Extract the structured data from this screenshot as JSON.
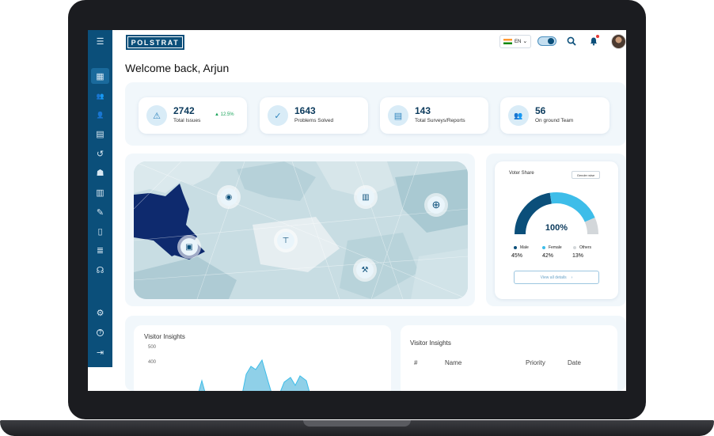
{
  "brand": {
    "name": "POLSTRAT"
  },
  "header": {
    "language": "EN",
    "language_chevron": "⌄",
    "icons": [
      "search-icon",
      "bell-icon"
    ]
  },
  "welcome": "Welcome back, Arjun",
  "sidebar": {
    "items": [
      {
        "icon": "menu-icon",
        "glyph": "☰"
      },
      {
        "icon": "dashboard-icon",
        "glyph": "▦",
        "active": true
      },
      {
        "icon": "team-icon",
        "glyph": "👥"
      },
      {
        "icon": "people-icon",
        "glyph": "👤"
      },
      {
        "icon": "document-icon",
        "glyph": "▤"
      },
      {
        "icon": "history-icon",
        "glyph": "↺"
      },
      {
        "icon": "voter-icon",
        "glyph": "☗"
      },
      {
        "icon": "report-icon",
        "glyph": "▥"
      },
      {
        "icon": "edit-icon",
        "glyph": "✎"
      },
      {
        "icon": "book-icon",
        "glyph": "▯"
      },
      {
        "icon": "list-icon",
        "glyph": "≣"
      },
      {
        "icon": "support-icon",
        "glyph": "☊"
      },
      {
        "icon": "settings-icon",
        "glyph": "⚙"
      },
      {
        "icon": "help-icon",
        "glyph": "?"
      },
      {
        "icon": "logout-icon",
        "glyph": "⇥"
      }
    ]
  },
  "stats": [
    {
      "value": "2742",
      "label": "Total Issues",
      "change": "▲ 12.5%",
      "icon": "warning-icon",
      "glyph": "⚠"
    },
    {
      "value": "1643",
      "label": "Problems Solved",
      "icon": "check-icon",
      "glyph": "✓"
    },
    {
      "value": "143",
      "label": "Total Surveys/Reports",
      "icon": "survey-icon",
      "glyph": "▤"
    },
    {
      "value": "56",
      "label": "On ground Team",
      "icon": "team-icon",
      "glyph": "👥"
    }
  ],
  "map": {
    "markers": [
      "binoculars-icon",
      "building-icon",
      "hospital-icon",
      "ambulance-icon",
      "water-tap-icon",
      "construction-icon"
    ],
    "colors": {
      "base": "#c8dde3",
      "highlight": "#0e2a6e",
      "shade": "#a9c9d2"
    }
  },
  "voter_share": {
    "title": "Voter Share",
    "filter": "Gender wise",
    "total": "100%",
    "segments": [
      {
        "name": "Male",
        "value": 45,
        "pct": "45%",
        "color": "#0b4f7a"
      },
      {
        "name": "Female",
        "value": 42,
        "pct": "42%",
        "color": "#3dbde9"
      },
      {
        "name": "Others",
        "value": 13,
        "pct": "13%",
        "color": "#d3d7da"
      }
    ],
    "button": "View all details",
    "button_icon": "›"
  },
  "visitor_insights": {
    "title": "Visitor Insights",
    "y_ticks": [
      "500",
      "400"
    ]
  },
  "visitor_table": {
    "title": "Visitor Insights",
    "columns": [
      "#",
      "Name",
      "Priority",
      "Date"
    ]
  }
}
